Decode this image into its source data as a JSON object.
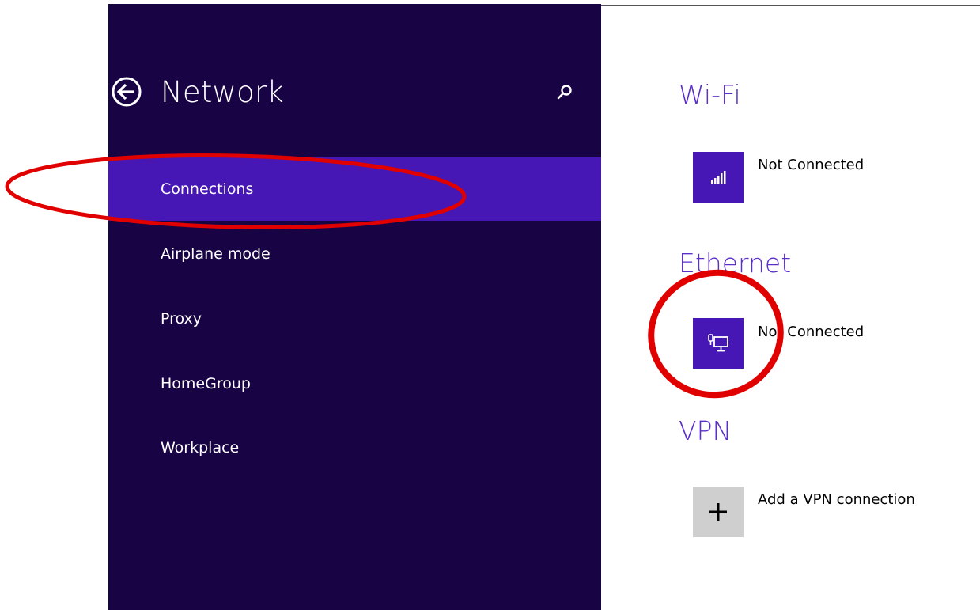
{
  "sidebar": {
    "title": "Network",
    "back_icon": "back-arrow-circle-icon",
    "search_icon": "search-icon",
    "items": [
      {
        "label": "Connections",
        "selected": true
      },
      {
        "label": "Airplane mode",
        "selected": false
      },
      {
        "label": "Proxy",
        "selected": false
      },
      {
        "label": "HomeGroup",
        "selected": false
      },
      {
        "label": "Workplace",
        "selected": false
      }
    ]
  },
  "content": {
    "wifi": {
      "heading": "Wi-Fi",
      "icon": "wifi-signal-icon",
      "status": "Not Connected"
    },
    "ethernet": {
      "heading": "Ethernet",
      "icon": "ethernet-computer-icon",
      "status": "Not Connected"
    },
    "vpn": {
      "heading": "VPN",
      "icon": "plus-icon",
      "add_label": "Add a VPN connection"
    }
  },
  "colors": {
    "sidebar_bg": "#180345",
    "accent": "#4617b4",
    "heading": "#5b2fc9",
    "annotation": "#e00000"
  }
}
